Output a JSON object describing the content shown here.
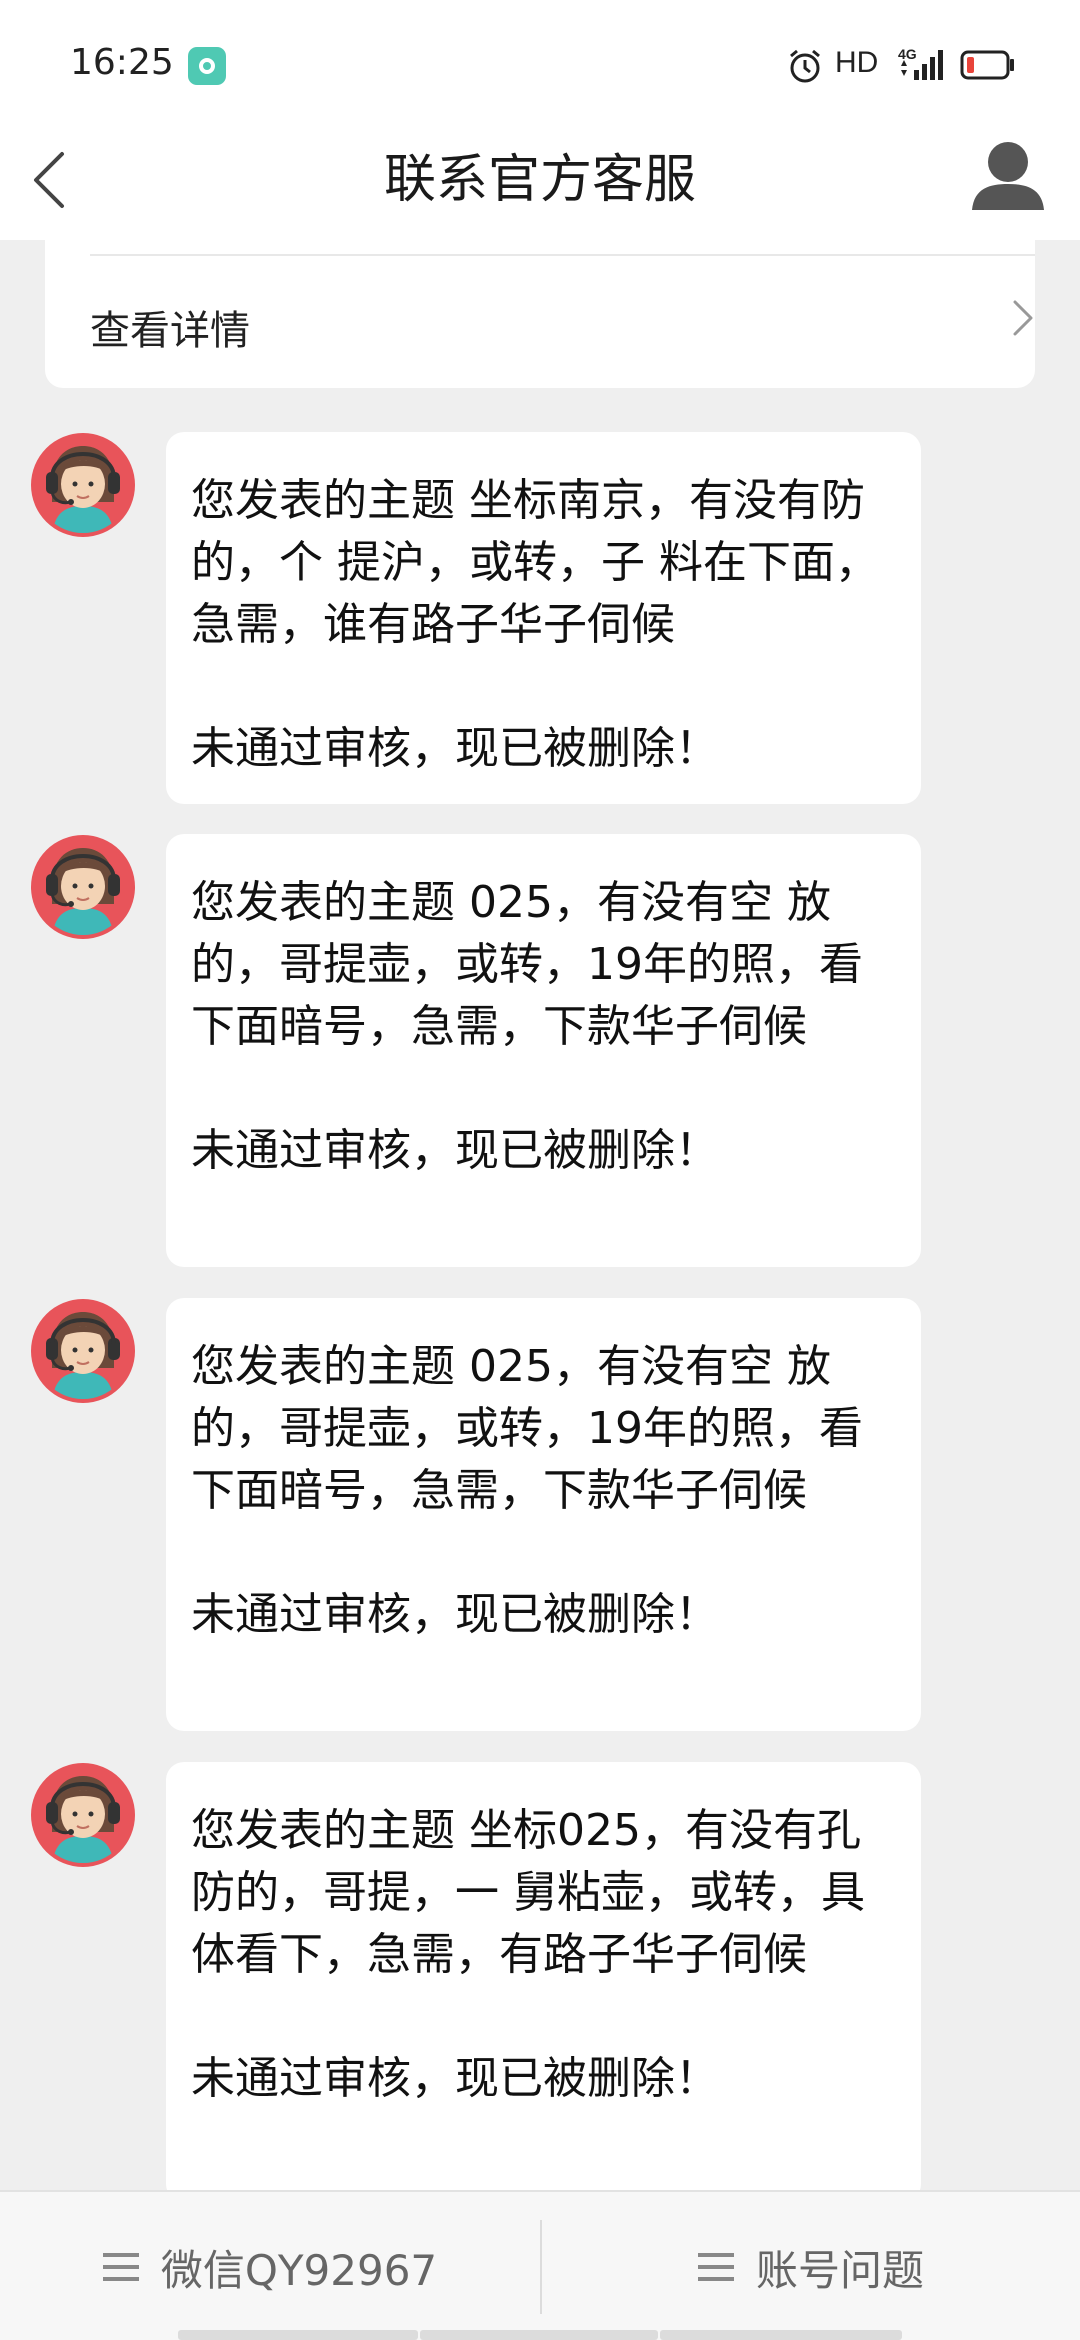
{
  "status_bar": {
    "time": "16:25",
    "hd": "HD",
    "network": "4G",
    "icons": [
      "notification-app-icon",
      "alarm-icon",
      "signal-icon",
      "battery-low-icon"
    ],
    "battery_color": "#e8443a"
  },
  "header": {
    "title": "联系官方客服",
    "back_icon": "chevron-left-icon",
    "profile_icon": "person-icon"
  },
  "detail_card": {
    "label": "查看详情"
  },
  "messages": [
    {
      "text": "您发表的主题 坐标南京，有没有防的，个 提沪，或转，子 料在下面，急需，谁有路子华子伺候",
      "status": "未通过审核，现已被删除！"
    },
    {
      "text": "您发表的主题 025，有没有空 放的，哥提壶，或转，19年的照，看下面暗号，急需，下款华子伺候",
      "status": "未通过审核，现已被删除！"
    },
    {
      "text": "您发表的主题 025，有没有空 放的，哥提壶，或转，19年的照，看下面暗号，急需，下款华子伺候",
      "status": "未通过审核，现已被删除！"
    },
    {
      "text": "您发表的主题 坐标025，有没有孔 防的，哥提，一 舅粘壶，或转，具体看下，急需，有路子华子伺候",
      "status": "未通过审核，现已被删除！"
    }
  ],
  "bottom_bar": {
    "left_label": "微信QY92967",
    "right_label": "账号问题"
  },
  "colors": {
    "background": "#efefef",
    "card": "#ffffff",
    "avatar_ring": "#e8545a",
    "avatar_shirt": "#3fb8b8"
  }
}
